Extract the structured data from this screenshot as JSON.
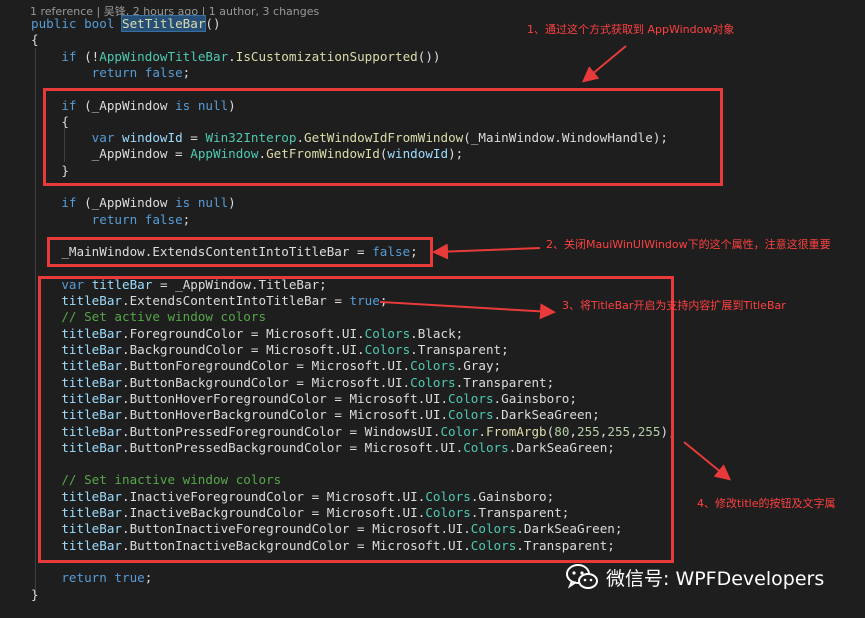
{
  "codelens": "1 reference | 吴锋, 2 hours ago | 1 author, 3 changes",
  "code_lines": [
    [
      [
        "kw",
        "public "
      ],
      [
        "kw",
        "bool "
      ],
      [
        "fn hl",
        "SetTitleBar"
      ],
      [
        "pl",
        "()"
      ]
    ],
    [
      [
        "pl",
        "{"
      ]
    ],
    [
      [
        "pl",
        "    "
      ],
      [
        "kw",
        "if "
      ],
      [
        "pl",
        "(!"
      ],
      [
        "ty",
        "AppWindowTitleBar"
      ],
      [
        "pl",
        "."
      ],
      [
        "fn",
        "IsCustomizationSupported"
      ],
      [
        "pl",
        "())"
      ]
    ],
    [
      [
        "pl",
        "        "
      ],
      [
        "kw",
        "return "
      ],
      [
        "kw",
        "false"
      ],
      [
        "pl",
        ";"
      ]
    ],
    [],
    [
      [
        "pl",
        "    "
      ],
      [
        "kw",
        "if "
      ],
      [
        "pl",
        "(_AppWindow "
      ],
      [
        "kw",
        "is null"
      ],
      [
        "pl",
        ")"
      ]
    ],
    [
      [
        "pl",
        "    {"
      ]
    ],
    [
      [
        "pl",
        "        "
      ],
      [
        "kw",
        "var "
      ],
      [
        "var",
        "windowId"
      ],
      [
        "pl",
        " = "
      ],
      [
        "ty",
        "Win32Interop"
      ],
      [
        "pl",
        "."
      ],
      [
        "fn",
        "GetWindowIdFromWindow"
      ],
      [
        "pl",
        "(_MainWindow.WindowHandle);"
      ]
    ],
    [
      [
        "pl",
        "        _AppWindow = "
      ],
      [
        "ty",
        "AppWindow"
      ],
      [
        "pl",
        "."
      ],
      [
        "fn",
        "GetFromWindowId"
      ],
      [
        "pl",
        "("
      ],
      [
        "var",
        "windowId"
      ],
      [
        "pl",
        ");"
      ]
    ],
    [
      [
        "pl",
        "    }"
      ]
    ],
    [],
    [
      [
        "pl",
        "    "
      ],
      [
        "kw",
        "if "
      ],
      [
        "pl",
        "(_AppWindow "
      ],
      [
        "kw",
        "is null"
      ],
      [
        "pl",
        ")"
      ]
    ],
    [
      [
        "pl",
        "        "
      ],
      [
        "kw",
        "return "
      ],
      [
        "kw",
        "false"
      ],
      [
        "pl",
        ";"
      ]
    ],
    [],
    [
      [
        "pl",
        "    _MainWindow.ExtendsContentIntoTitleBar = "
      ],
      [
        "kw",
        "false"
      ],
      [
        "pl",
        ";"
      ]
    ],
    [],
    [
      [
        "pl",
        "    "
      ],
      [
        "kw",
        "var "
      ],
      [
        "var",
        "titleBar"
      ],
      [
        "pl",
        " = _AppWindow.TitleBar;"
      ]
    ],
    [
      [
        "pl",
        "    "
      ],
      [
        "var",
        "titleBar"
      ],
      [
        "pl",
        ".ExtendsContentIntoTitleBar = "
      ],
      [
        "kw",
        "true"
      ],
      [
        "pl",
        ";"
      ]
    ],
    [
      [
        "cm",
        "    // Set active window colors"
      ]
    ],
    [
      [
        "pl",
        "    "
      ],
      [
        "var",
        "titleBar"
      ],
      [
        "pl",
        ".ForegroundColor = Microsoft.UI."
      ],
      [
        "ty",
        "Colors"
      ],
      [
        "pl",
        ".Black;"
      ]
    ],
    [
      [
        "pl",
        "    "
      ],
      [
        "var",
        "titleBar"
      ],
      [
        "pl",
        ".BackgroundColor = Microsoft.UI."
      ],
      [
        "ty",
        "Colors"
      ],
      [
        "pl",
        ".Transparent;"
      ]
    ],
    [
      [
        "pl",
        "    "
      ],
      [
        "var",
        "titleBar"
      ],
      [
        "pl",
        ".ButtonForegroundColor = Microsoft.UI."
      ],
      [
        "ty",
        "Colors"
      ],
      [
        "pl",
        ".Gray;"
      ]
    ],
    [
      [
        "pl",
        "    "
      ],
      [
        "var",
        "titleBar"
      ],
      [
        "pl",
        ".ButtonBackgroundColor = Microsoft.UI."
      ],
      [
        "ty",
        "Colors"
      ],
      [
        "pl",
        ".Transparent;"
      ]
    ],
    [
      [
        "pl",
        "    "
      ],
      [
        "var",
        "titleBar"
      ],
      [
        "pl",
        ".ButtonHoverForegroundColor = Microsoft.UI."
      ],
      [
        "ty",
        "Colors"
      ],
      [
        "pl",
        ".Gainsboro;"
      ]
    ],
    [
      [
        "pl",
        "    "
      ],
      [
        "var",
        "titleBar"
      ],
      [
        "pl",
        ".ButtonHoverBackgroundColor = Microsoft.UI."
      ],
      [
        "ty",
        "Colors"
      ],
      [
        "pl",
        ".DarkSeaGreen;"
      ]
    ],
    [
      [
        "pl",
        "    "
      ],
      [
        "var",
        "titleBar"
      ],
      [
        "pl",
        ".ButtonPressedForegroundColor = WindowsUI."
      ],
      [
        "ty",
        "Color"
      ],
      [
        "pl",
        "."
      ],
      [
        "fn",
        "FromArgb"
      ],
      [
        "pl",
        "("
      ],
      [
        "num",
        "80"
      ],
      [
        "pl",
        ","
      ],
      [
        "num",
        "255"
      ],
      [
        "pl",
        ","
      ],
      [
        "num",
        "255"
      ],
      [
        "pl",
        ","
      ],
      [
        "num",
        "255"
      ],
      [
        "pl",
        ");"
      ]
    ],
    [
      [
        "pl",
        "    "
      ],
      [
        "var",
        "titleBar"
      ],
      [
        "pl",
        ".ButtonPressedBackgroundColor = Microsoft.UI."
      ],
      [
        "ty",
        "Colors"
      ],
      [
        "pl",
        ".DarkSeaGreen;"
      ]
    ],
    [],
    [
      [
        "cm",
        "    // Set inactive window colors"
      ]
    ],
    [
      [
        "pl",
        "    "
      ],
      [
        "var",
        "titleBar"
      ],
      [
        "pl",
        ".InactiveForegroundColor = Microsoft.UI."
      ],
      [
        "ty",
        "Colors"
      ],
      [
        "pl",
        ".Gainsboro;"
      ]
    ],
    [
      [
        "pl",
        "    "
      ],
      [
        "var",
        "titleBar"
      ],
      [
        "pl",
        ".InactiveBackgroundColor = Microsoft.UI."
      ],
      [
        "ty",
        "Colors"
      ],
      [
        "pl",
        ".Transparent;"
      ]
    ],
    [
      [
        "pl",
        "    "
      ],
      [
        "var",
        "titleBar"
      ],
      [
        "pl",
        ".ButtonInactiveForegroundColor = Microsoft.UI."
      ],
      [
        "ty",
        "Colors"
      ],
      [
        "pl",
        ".DarkSeaGreen;"
      ]
    ],
    [
      [
        "pl",
        "    "
      ],
      [
        "var",
        "titleBar"
      ],
      [
        "pl",
        ".ButtonInactiveBackgroundColor = Microsoft.UI."
      ],
      [
        "ty",
        "Colors"
      ],
      [
        "pl",
        ".Transparent;"
      ]
    ],
    [],
    [
      [
        "pl",
        "    "
      ],
      [
        "kw",
        "return "
      ],
      [
        "kw",
        "true"
      ],
      [
        "pl",
        ";"
      ]
    ],
    [
      [
        "pl",
        "}"
      ]
    ]
  ],
  "annotations": {
    "note1": "1、通过这个方式获取到 AppWindow对象",
    "note2": "2、关闭MauiWinUIWindow下的这个属性，注意这很重要",
    "note3": "3、将TitleBar开启为支持内容扩展到TitleBar",
    "note4": "4、修改title的按钮及文字属"
  },
  "watermark": {
    "text": "微信号: WPFDevelopers",
    "icon": "wechat-icon"
  },
  "colors": {
    "annotation": "#e83a3a",
    "background": "#1e1e1e"
  }
}
